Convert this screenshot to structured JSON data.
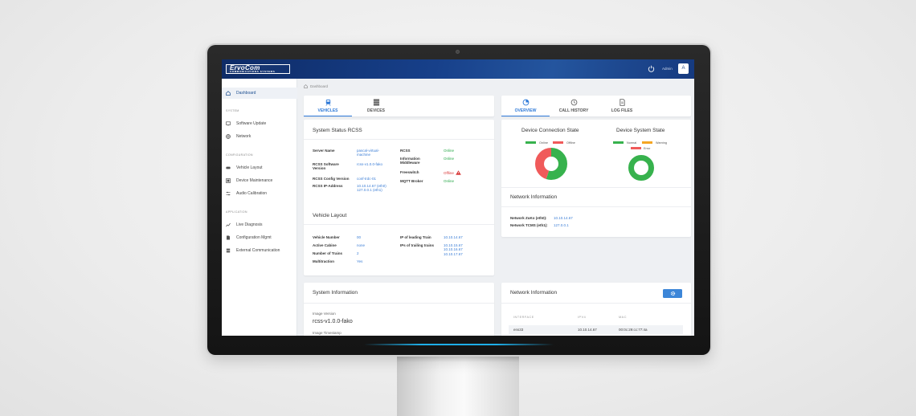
{
  "header": {
    "logo_text": "ErvoCom",
    "logo_subtext": "COMMUNICATIONS SYSTEMS",
    "admin_label": "Admin",
    "avatar_initial": "A",
    "colors": {
      "header_bg": "#17408a",
      "accent": "#2f7ad8"
    }
  },
  "breadcrumb": "Dashboard",
  "sidebar": {
    "dashboard": "Dashboard",
    "sections": {
      "system": "SYSTEM",
      "configuration": "CONFIGURATION",
      "application": "APPLICATION"
    },
    "system_items": [
      "Software Update",
      "Network"
    ],
    "configuration_items": [
      "Vehicle Layout",
      "Device Maintenance",
      "Audio Calibration"
    ],
    "application_items": [
      "Live Diagnosis",
      "Configuration Mgmt",
      "External Communication"
    ]
  },
  "left_panel": {
    "tabs": [
      "VEHICLES",
      "DEVICES"
    ],
    "system_status_title": "System Status RCSS",
    "system_status": {
      "server_name_label": "Server Name",
      "server_name_value": [
        "pascal-virtual-",
        "machine"
      ],
      "rcss_sw_label": [
        "RCSS Software",
        "Version"
      ],
      "rcss_sw_value": "rcss-v1.0.0-fako",
      "rcss_config_label": "RCSS Config Version",
      "rcss_config_value": "conf-trdc-01",
      "rcss_ip_label": "RCSS IP-Address",
      "rcss_ip_value": [
        "10.10.14.67 (eth0)",
        "127.0.0.1 (eth1)"
      ],
      "services": [
        {
          "label": [
            "RCSS"
          ],
          "state": "Online",
          "ok": true
        },
        {
          "label": [
            "Information",
            "Middleware"
          ],
          "state": "Online",
          "ok": true
        },
        {
          "label": [
            "Freeswitch"
          ],
          "state": "Offline",
          "ok": false
        },
        {
          "label": [
            "MQTT Broker"
          ],
          "state": "Online",
          "ok": true
        }
      ]
    },
    "vehicle_layout_title": "Vehicle Layout",
    "vehicle_layout": {
      "vehicle_number_label": "Vehicle Number",
      "vehicle_number_value": "00",
      "active_cabine_label": "Active Cabine",
      "active_cabine_value": "none",
      "number_of_trains_label": "Number of Trains",
      "number_of_trains_value": "2",
      "multitraction_label": "Multitraction",
      "multitraction_value": "Yes",
      "ip_leading_label": "IP of leading Train",
      "ip_leading_value": "10.10.14.67",
      "ips_trailing_label": "IPs of trailing trains",
      "ips_trailing_value": [
        "10.10.15.67",
        "10.10.16.67",
        "10.10.17.67"
      ]
    },
    "system_information_title": "System Information",
    "image_version_label": "Image Version",
    "image_version_value": "rcss-v1.0.0-fako",
    "image_timestamp_label": "Image Timestamp"
  },
  "right_panel": {
    "tabs": [
      "OVERVIEW",
      "CALL HISTORY",
      "LOG FILES"
    ],
    "device_connection_title": "Device Connection State",
    "device_connection_legend": [
      {
        "label": "Online",
        "color": "#37b24d"
      },
      {
        "label": "Offline",
        "color": "#f05a5a"
      }
    ],
    "device_connection_values": {
      "online": 0.55,
      "offline": 0.45
    },
    "device_system_title": "Device System State",
    "device_system_legend": [
      {
        "label": "Normal",
        "color": "#37b24d"
      },
      {
        "label": "Warning",
        "color": "#f5a623"
      },
      {
        "label": "Error",
        "color": "#f05a5a"
      }
    ],
    "device_system_values": {
      "normal": 1.0,
      "warning": 0.0,
      "error": 0.0
    },
    "network_info_title": "Network Information",
    "network_zukto_label": "Network ZuKo (eth0):",
    "network_zukto_value": "10.10.14.67",
    "network_tcms_label": "Network TCMS (eth1):",
    "network_tcms_value": "127.0.0.1",
    "network_table_title": "Network Information",
    "network_table": {
      "headers": [
        "INTERFACE",
        "IPV4",
        "MAC"
      ],
      "rows": [
        [
          "ens33",
          "10.10.14.67",
          "00:0c:29:cc:77:4a"
        ]
      ]
    }
  }
}
